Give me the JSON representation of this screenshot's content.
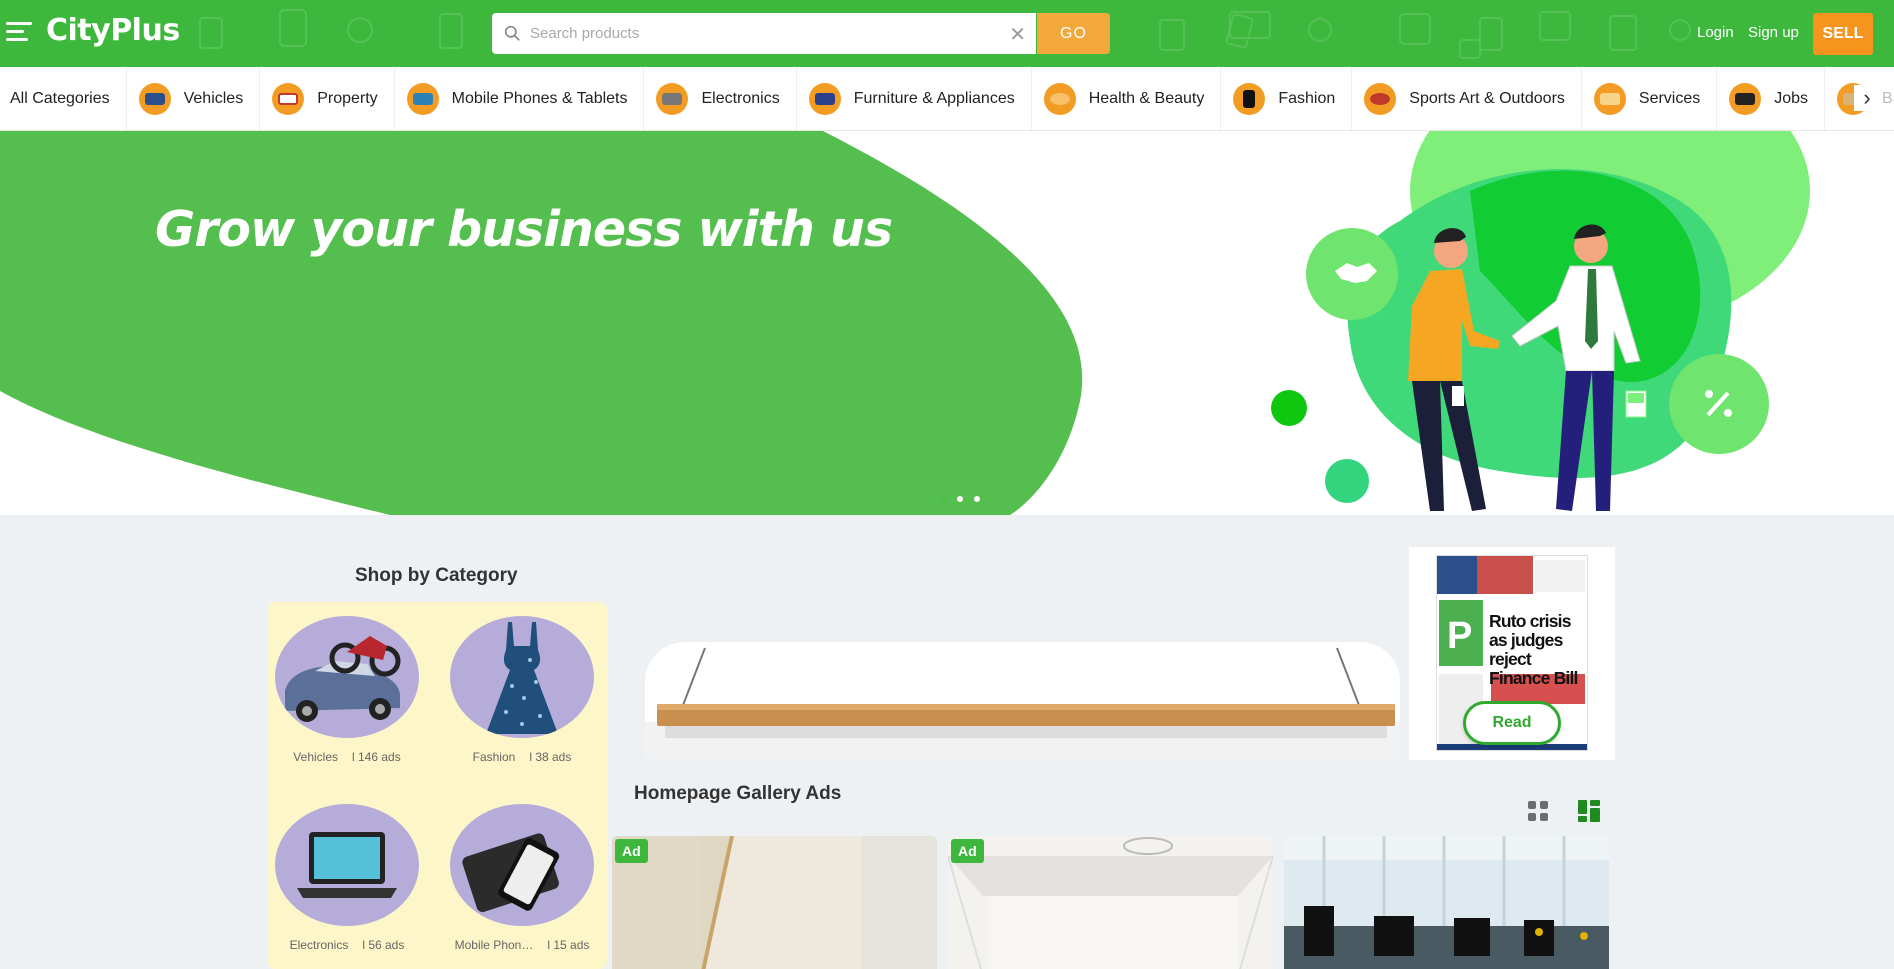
{
  "brand": {
    "name": "CityPlus",
    "primary_color": "#3db83d",
    "accent_color": "#f3a83b",
    "sell_color": "#f7941d"
  },
  "header": {
    "menu_icon": "hamburger-menu-icon",
    "search": {
      "placeholder": "Search products",
      "value": "",
      "go_label": "GO"
    },
    "login_label": "Login",
    "signup_label": "Sign up",
    "sell_label": "SELL"
  },
  "categories_nav": {
    "all_label": "All Categories",
    "items": [
      {
        "label": "Vehicles",
        "icon": "car-icon"
      },
      {
        "label": "Property",
        "icon": "house-icon"
      },
      {
        "label": "Mobile Phones & Tablets",
        "icon": "phone-icon"
      },
      {
        "label": "Electronics",
        "icon": "electronics-icon"
      },
      {
        "label": "Furniture & Appliances",
        "icon": "sofa-icon"
      },
      {
        "label": "Health & Beauty",
        "icon": "beauty-icon"
      },
      {
        "label": "Fashion",
        "icon": "dress-icon"
      },
      {
        "label": "Sports Art & Outdoors",
        "icon": "sports-icon"
      },
      {
        "label": "Services",
        "icon": "services-icon"
      },
      {
        "label": "Jobs",
        "icon": "jobs-icon"
      },
      {
        "label": "Babies",
        "icon": "baby-icon"
      }
    ],
    "next_icon": "chevron-right-icon"
  },
  "hero": {
    "title": "Grow your business with us",
    "slides_total": 3,
    "active_slide": 1
  },
  "shop_by_category": {
    "title": "Shop by Category",
    "cards": [
      {
        "name": "Vehicles",
        "count": "l 146 ads",
        "icon": "vehicles-image"
      },
      {
        "name": "Fashion",
        "count": "l 38 ads",
        "icon": "dress-image"
      },
      {
        "name": "Electronics",
        "count": "l 56 ads",
        "icon": "laptop-image"
      },
      {
        "name": "Mobile Phon…",
        "count": "l 15 ads",
        "icon": "phones-image"
      }
    ]
  },
  "newspaper": {
    "headline": "Ruto crisis as judges reject Finance Bill",
    "read_label": "Read"
  },
  "gallery": {
    "title": "Homepage Gallery Ads",
    "ads": [
      {
        "badge": "Ad"
      },
      {
        "badge": "Ad"
      },
      {
        "badge": ""
      }
    ]
  }
}
